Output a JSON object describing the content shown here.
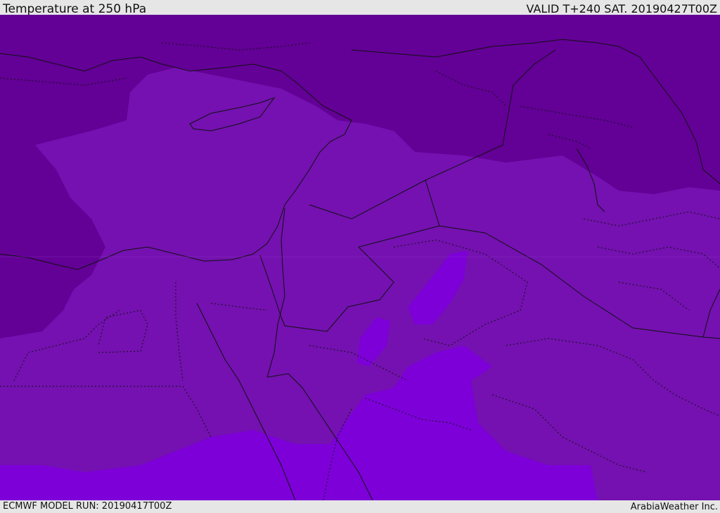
{
  "header": {
    "title": "Temperature at 250 hPa",
    "valid_time": "VALID T+240 SAT. 20190427T00Z"
  },
  "footer": {
    "model_run": "ECMWF MODEL RUN: 20190417T00Z",
    "credit": "ArabiaWeather Inc."
  },
  "colors": {
    "cold_band": "#630096",
    "mid_band": "#7411b0",
    "warm_band": "#7d00d9",
    "background_band": "#6f0aa8",
    "borders": "#111111"
  },
  "map": {
    "variable": "Temperature",
    "level": "250 hPa",
    "forecast_hour": "T+240"
  }
}
